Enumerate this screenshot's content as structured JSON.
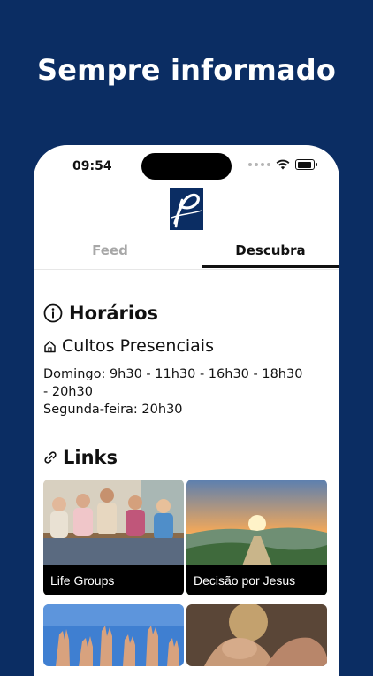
{
  "headline": "Sempre informado",
  "status_bar": {
    "time": "09:54"
  },
  "tabs": [
    {
      "label": "Feed"
    },
    {
      "label": "Descubra"
    }
  ],
  "horarios": {
    "title": "Horários",
    "subtitle": "Cultos Presenciais",
    "lines": [
      "Domingo: 9h30 - 11h30 - 16h30 - 18h30 - 20h30",
      "Segunda-feira: 20h30"
    ]
  },
  "links": {
    "title": "Links",
    "cards": [
      {
        "label": "Life Groups"
      },
      {
        "label": "Decisão por Jesus"
      }
    ]
  },
  "colors": {
    "background": "#0b2d63",
    "accent": "#0b2d63"
  }
}
